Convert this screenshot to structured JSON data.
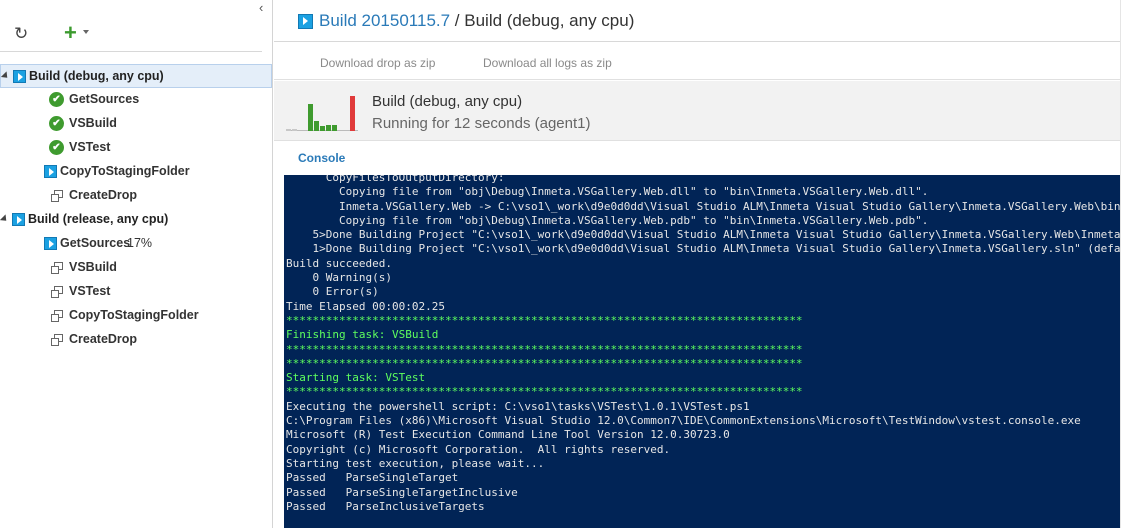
{
  "header": {
    "build_link": "Build 20150115.7",
    "separator": " / ",
    "title_suffix": "Build (debug, any cpu)"
  },
  "actions": {
    "download_drop": "Download drop as zip",
    "download_logs": "Download all logs as zip"
  },
  "summary": {
    "title": "Build (debug, any cpu)",
    "status": "Running for 12 seconds (agent1)",
    "history_bars": [
      {
        "value": 0.05,
        "color": "#c8c8c8"
      },
      {
        "value": 0.06,
        "color": "#c8c8c8"
      },
      {
        "value": 0.72,
        "color": "#3f9b2f"
      },
      {
        "value": 0.25,
        "color": "#3f9b2f"
      },
      {
        "value": 0.12,
        "color": "#3f9b2f"
      },
      {
        "value": 0.15,
        "color": "#3f9b2f"
      },
      {
        "value": 0.15,
        "color": "#3f9b2f"
      },
      {
        "value": 0.92,
        "color": "#e03a3a"
      }
    ]
  },
  "tabs": {
    "console": "Console"
  },
  "sidebar": {
    "tree": [
      {
        "label": "Build (debug, any cpu)",
        "type": "group",
        "icon": "play-icon",
        "selected": true
      },
      {
        "label": "GetSources",
        "type": "child",
        "icon": "check-icon"
      },
      {
        "label": "VSBuild",
        "type": "child",
        "icon": "check-icon"
      },
      {
        "label": "VSTest",
        "type": "child",
        "icon": "check-icon"
      },
      {
        "label": "CopyToStagingFolder",
        "type": "child",
        "icon": "play-icon",
        "indent": "less"
      },
      {
        "label": "CreateDrop",
        "type": "child",
        "icon": "task-icon"
      },
      {
        "label": "Build (release, any cpu)",
        "type": "group",
        "icon": "play-icon"
      },
      {
        "label": "GetSources",
        "type": "child",
        "icon": "play-icon",
        "indent": "less",
        "progress": "17%"
      },
      {
        "label": "VSBuild",
        "type": "child",
        "icon": "task-icon"
      },
      {
        "label": "VSTest",
        "type": "child",
        "icon": "task-icon"
      },
      {
        "label": "CopyToStagingFolder",
        "type": "child",
        "icon": "task-icon"
      },
      {
        "label": "CreateDrop",
        "type": "child",
        "icon": "task-icon"
      }
    ]
  },
  "console": {
    "lines": [
      {
        "text": "      CopyFilesToOutputDirectory:",
        "green": false
      },
      {
        "text": "        Copying file from \"obj\\Debug\\Inmeta.VSGallery.Web.dll\" to \"bin\\Inmeta.VSGallery.Web.dll\".",
        "green": false
      },
      {
        "text": "        Inmeta.VSGallery.Web -> C:\\vso1\\_work\\d9e0d0dd\\Visual Studio ALM\\Inmeta Visual Studio Gallery\\Inmeta.VSGallery.Web\\bin",
        "green": false
      },
      {
        "text": "        Copying file from \"obj\\Debug\\Inmeta.VSGallery.Web.pdb\" to \"bin\\Inmeta.VSGallery.Web.pdb\".",
        "green": false
      },
      {
        "text": "    5>Done Building Project \"C:\\vso1\\_work\\d9e0d0dd\\Visual Studio ALM\\Inmeta Visual Studio Gallery\\Inmeta.VSGallery.Web\\Inmeta",
        "green": false
      },
      {
        "text": "    1>Done Building Project \"C:\\vso1\\_work\\d9e0d0dd\\Visual Studio ALM\\Inmeta Visual Studio Gallery\\Inmeta.VSGallery.sln\" (defa",
        "green": false
      },
      {
        "text": "Build succeeded.",
        "green": false
      },
      {
        "text": "    0 Warning(s)",
        "green": false
      },
      {
        "text": "    0 Error(s)",
        "green": false
      },
      {
        "text": "Time Elapsed 00:00:02.25",
        "green": false
      },
      {
        "text": "******************************************************************************",
        "green": true
      },
      {
        "text": "Finishing task: VSBuild",
        "green": true
      },
      {
        "text": "******************************************************************************",
        "green": true
      },
      {
        "text": "******************************************************************************",
        "green": true
      },
      {
        "text": "Starting task: VSTest",
        "green": true
      },
      {
        "text": "******************************************************************************",
        "green": true
      },
      {
        "text": "Executing the powershell script: C:\\vso1\\tasks\\VSTest\\1.0.1\\VSTest.ps1",
        "green": false
      },
      {
        "text": "C:\\Program Files (x86)\\Microsoft Visual Studio 12.0\\Common7\\IDE\\CommonExtensions\\Microsoft\\TestWindow\\vstest.console.exe",
        "green": false
      },
      {
        "text": "Microsoft (R) Test Execution Command Line Tool Version 12.0.30723.0",
        "green": false
      },
      {
        "text": "Copyright (c) Microsoft Corporation.  All rights reserved.",
        "green": false
      },
      {
        "text": "Starting test execution, please wait...",
        "green": false
      },
      {
        "text": "Passed   ParseSingleTarget",
        "green": false
      },
      {
        "text": "Passed   ParseSingleTargetInclusive",
        "green": false
      },
      {
        "text": "Passed   ParseInclusiveTargets",
        "green": false
      }
    ]
  }
}
